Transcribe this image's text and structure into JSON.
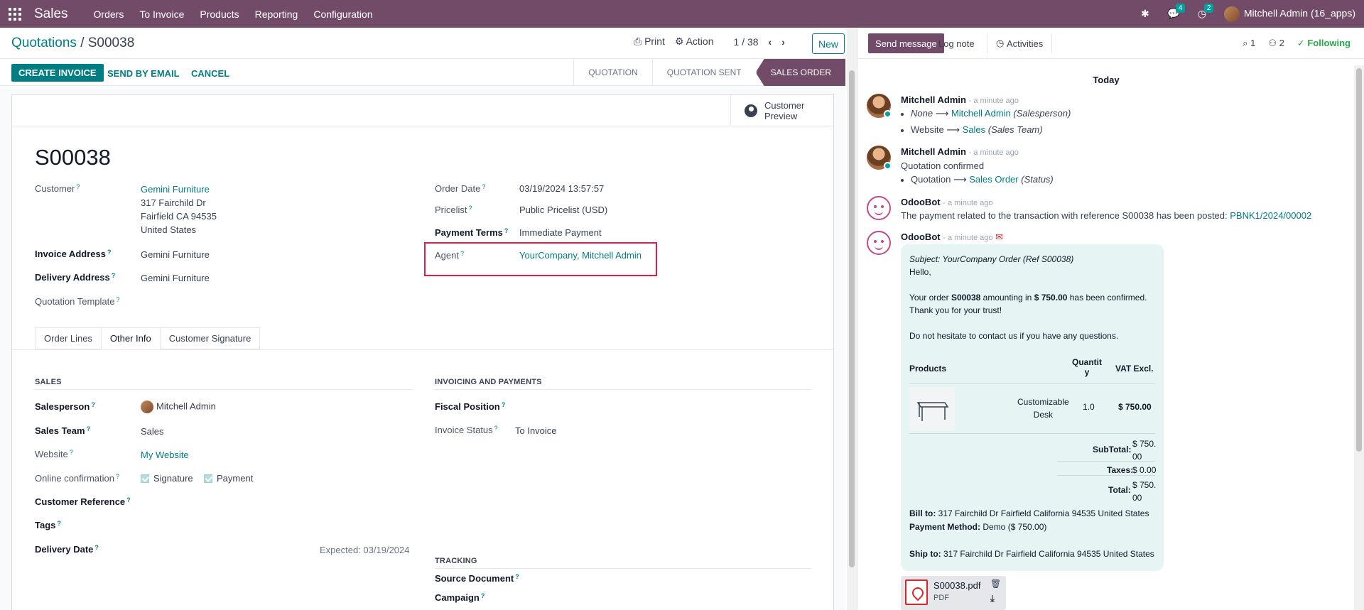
{
  "topnav": {
    "app_name": "Sales",
    "menu": [
      "Orders",
      "To Invoice",
      "Products",
      "Reporting",
      "Configuration"
    ],
    "messages_count": "4",
    "activities_count": "2",
    "user": "Mitchell Admin (16_apps)"
  },
  "control_panel": {
    "breadcrumb_root": "Quotations",
    "breadcrumb_sep": "/",
    "record": "S00038",
    "print": "Print",
    "action": "Action",
    "pager": "1 / 38",
    "new": "New"
  },
  "statusbar": {
    "create_invoice": "CREATE INVOICE",
    "send_email": "SEND BY EMAIL",
    "cancel": "CANCEL",
    "stages": [
      "QUOTATION",
      "QUOTATION SENT",
      "SALES ORDER"
    ],
    "active_stage": "SALES ORDER"
  },
  "sheet": {
    "customer_preview": [
      "Customer",
      "Preview"
    ],
    "title": "S00038",
    "customer_label": "Customer",
    "customer_name": "Gemini Furniture",
    "customer_addr": [
      "317 Fairchild Dr",
      "Fairfield CA 94535",
      "United States"
    ],
    "invoice_address_label": "Invoice Address",
    "invoice_address": "Gemini Furniture",
    "delivery_address_label": "Delivery Address",
    "delivery_address": "Gemini Furniture",
    "quotation_template_label": "Quotation Template",
    "order_date_label": "Order Date",
    "order_date": "03/19/2024 13:57:57",
    "pricelist_label": "Pricelist",
    "pricelist": "Public Pricelist (USD)",
    "payment_terms_label": "Payment Terms",
    "payment_terms": "Immediate Payment",
    "agent_label": "Agent",
    "agent": "YourCompany, Mitchell Admin",
    "tabs": [
      "Order Lines",
      "Other Info",
      "Customer Signature"
    ],
    "sales_section": "SALES",
    "salesperson_label": "Salesperson",
    "salesperson": "Mitchell Admin",
    "sales_team_label": "Sales Team",
    "sales_team": "Sales",
    "website_label": "Website",
    "website": "My Website",
    "online_conf_label": "Online confirmation",
    "signature": "Signature",
    "payment": "Payment",
    "customer_ref_label": "Customer Reference",
    "tags_label": "Tags",
    "delivery_date_label": "Delivery Date",
    "expected": "Expected: 03/19/2024",
    "invoicing_section": "INVOICING AND PAYMENTS",
    "fiscal_position_label": "Fiscal Position",
    "invoice_status_label": "Invoice Status",
    "invoice_status": "To Invoice",
    "tracking_section": "TRACKING",
    "source_doc_label": "Source Document",
    "campaign_label": "Campaign"
  },
  "chatter": {
    "send_message": "Send message",
    "log_note": "Log note",
    "activities": "Activities",
    "attachments": "1",
    "followers": "2",
    "following": "Following",
    "today": "Today",
    "m1_author": "Mitchell Admin",
    "ago": "- a minute ago",
    "m1_l1_from": "None",
    "m1_l1_to": "Mitchell Admin",
    "m1_l1_field": "(Salesperson)",
    "m1_l2_from": "Website",
    "m1_l2_to": "Sales",
    "m1_l2_field": "(Sales Team)",
    "m2_author": "Mitchell Admin",
    "m2_text": "Quotation confirmed",
    "m2_from": "Quotation",
    "m2_to": "Sales Order",
    "m2_field": "(Status)",
    "m3_author": "OdooBot",
    "m3_text": "The payment related to the transaction with reference S00038 has been posted:",
    "m3_link": "PBNK1/2024/00002",
    "m4_author": "OdooBot",
    "mail": {
      "subject": "Subject: YourCompany Order (Ref S00038)",
      "hello": "Hello,",
      "l1a": "Your order ",
      "l1b": "S00038",
      "l1c": " amounting in ",
      "l1d": "$ 750.00",
      "l1e": " has been confirmed.",
      "l2": "Thank you for your trust!",
      "l3": "Do not hesitate to contact us if you have any questions.",
      "h_products": "Products",
      "h_qty1": "Quantit",
      "h_qty2": "y",
      "h_vat": "VAT Excl.",
      "prod1": "Customizable",
      "prod2": "Desk",
      "qty": "1.0",
      "price": "$ 750.00",
      "subtotal_label": "SubTotal:",
      "subtotal1": "$ 750.",
      "subtotal2": "00",
      "taxes_label": "Taxes:",
      "taxes": "$ 0.00",
      "total_label": "Total:",
      "total1": "$ 750.",
      "total2": "00",
      "bill_label": "Bill to:",
      "bill": " 317 Fairchild Dr Fairfield California 94535 United States",
      "pm_label": "Payment Method:",
      "pm": " Demo ($ 750.00)",
      "ship_label": "Ship to:",
      "ship": " 317 Fairchild Dr Fairfield California 94535 United States"
    },
    "att_name": "S00038.pdf",
    "att_type": "PDF"
  }
}
